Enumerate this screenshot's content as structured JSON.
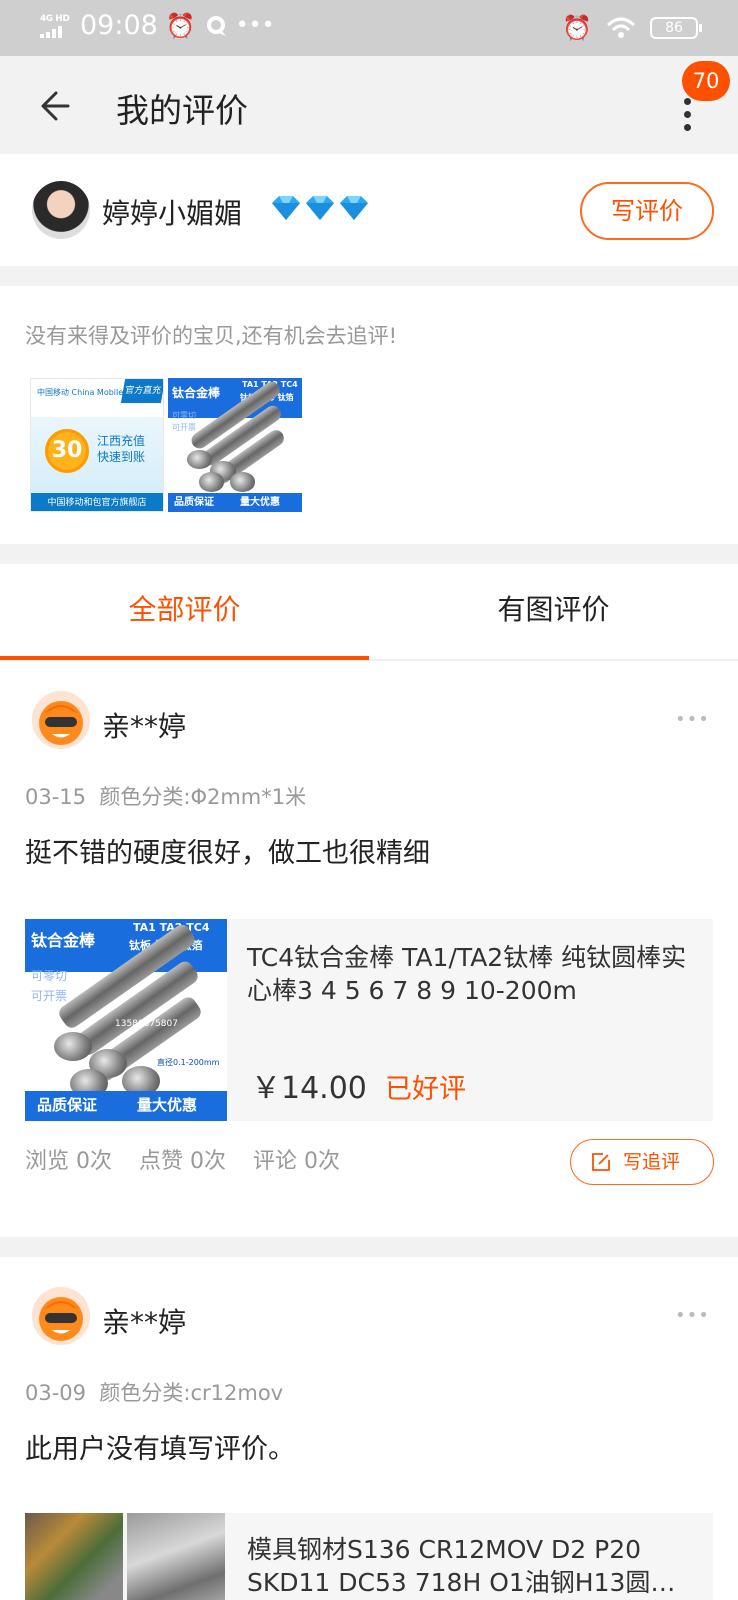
{
  "status_bar": {
    "network": "4G HD",
    "time": "09:08",
    "battery": "86"
  },
  "nav": {
    "title": "我的评价",
    "badge": "70"
  },
  "user": {
    "name": "婷婷小媚媚",
    "write_review": "写评价"
  },
  "pending": {
    "tip": "没有来得及评价的宝贝,还有机会去追评!",
    "items": [
      {
        "type": "mobile-recharge",
        "logo": "中国移动 China Mobile",
        "flag": "官方直充",
        "amount": "30",
        "line1": "江西充值",
        "line2": "快速到账",
        "footer": "中国移动和包官方旗舰店"
      },
      {
        "type": "titanium-rod",
        "title": "钛合金棒",
        "grades": "TA1 TA2 TC4",
        "sub": "钛板 钛棒 钛箔",
        "left1": "可零切",
        "left2": "可开票",
        "quality": "品质保证",
        "discount": "量大优惠"
      }
    ]
  },
  "tabs": {
    "all": "全部评价",
    "with_images": "有图评价"
  },
  "reviews": [
    {
      "user": "亲**婷",
      "date": "03-15",
      "spec": "颜色分类:Φ2mm*1米",
      "text": "挺不错的硬度很好，做工也很精细",
      "product_title": "TC4钛合金棒 TA1/TA2钛棒 纯钛圆棒实心棒3 4 5 6 7 8 9 10-200m",
      "price": "￥14.00",
      "status": "已好评",
      "views": "浏览 0次",
      "likes": "点赞 0次",
      "comments": "评论 0次",
      "followup": "写追评",
      "img": {
        "title": "钛合金棒",
        "grades": "TA1 TA2 TC4",
        "sub": "钛板 钛棒 钛箔",
        "left1": "可零切",
        "left2": "可开票",
        "phone": "13580875807",
        "size": "直径0.1-200mm",
        "quality": "品质保证",
        "discount": "量大优惠"
      }
    },
    {
      "user": "亲**婷",
      "date": "03-09",
      "spec": "颜色分类:cr12mov",
      "text": "此用户没有填写评价。",
      "product_title": "模具钢材S136 CR12MOV D2 P20 SKD11 DC53 718H O1油钢H13圆…"
    }
  ]
}
